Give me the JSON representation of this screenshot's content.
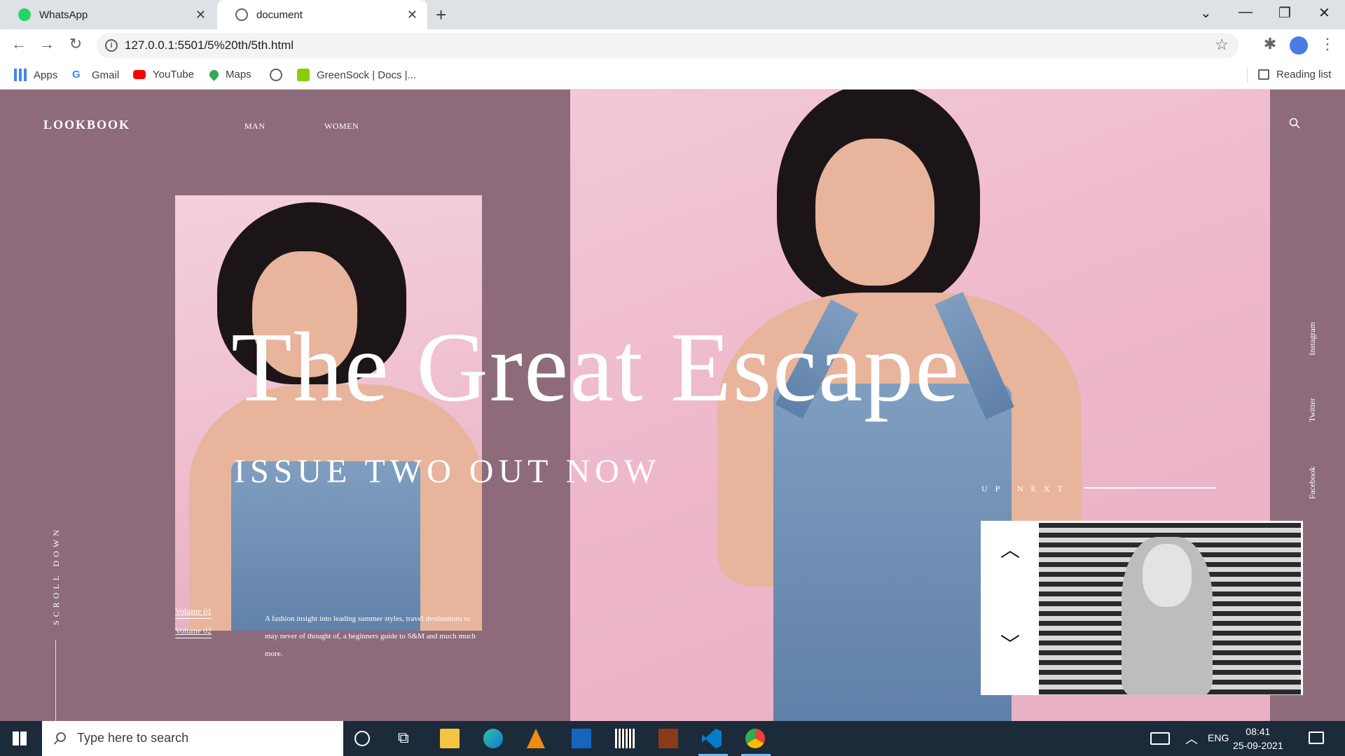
{
  "browser": {
    "tabs": [
      {
        "label": "WhatsApp",
        "icon": "whatsapp-icon",
        "color": "#25d366"
      },
      {
        "label": "document",
        "icon": "globe-icon",
        "active": true
      }
    ],
    "url": "127.0.0.1:5501/5%20th/5th.html",
    "bookmarks": [
      {
        "label": "Apps",
        "icon": "apps-grid-icon"
      },
      {
        "label": "Gmail",
        "icon": "google-icon"
      },
      {
        "label": "YouTube",
        "icon": "youtube-icon"
      },
      {
        "label": "Maps",
        "icon": "maps-pin-icon"
      },
      {
        "label": "",
        "icon": "globe-icon"
      },
      {
        "label": "GreenSock | Docs |...",
        "icon": "greensock-icon"
      }
    ],
    "reading_list": "Reading list"
  },
  "site": {
    "logo": "LOOKBOOK",
    "nav": [
      "MAN",
      "WOMEN"
    ],
    "hero_title": "The Great Escape",
    "hero_subtitle": "ISSUE TWO OUT NOW",
    "scroll_label": "SCROLL DOWN",
    "volumes": [
      "Volume 01",
      "Volume 02"
    ],
    "description": "A fashion insight into leading summer styles, travel destinations to may never of thought of, a beginners guide to S&M and much much more.",
    "up_next": "UP NEXT",
    "social": [
      "Instagram",
      "Twitter",
      "Facebook"
    ],
    "colors": {
      "background": "#8d6b7b",
      "hero_pink": "#eeb8cb",
      "text": "#ffffff"
    }
  },
  "taskbar": {
    "search_placeholder": "Type here to search",
    "language": "ENG",
    "time": "08:41",
    "date": "25-09-2021"
  }
}
